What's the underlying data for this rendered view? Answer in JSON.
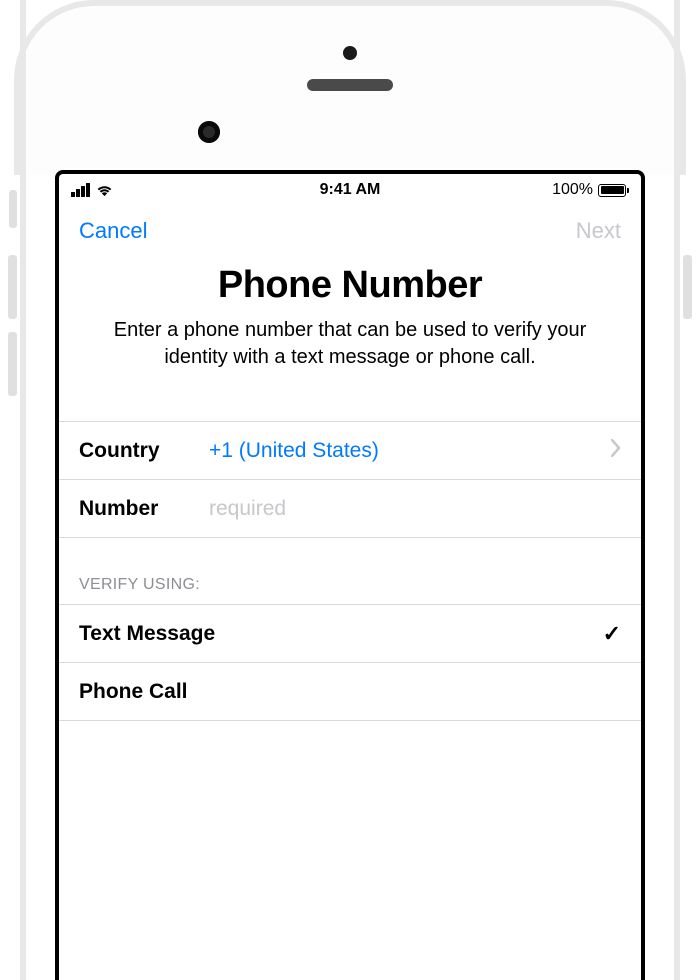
{
  "status_bar": {
    "time": "9:41 AM",
    "battery_pct": "100%"
  },
  "nav": {
    "cancel": "Cancel",
    "next": "Next"
  },
  "header": {
    "title": "Phone Number",
    "subtitle": "Enter a phone number that can be used to verify your identity with a text message or phone call."
  },
  "form": {
    "country_label": "Country",
    "country_value": "+1 (United States)",
    "number_label": "Number",
    "number_placeholder": "required"
  },
  "verify": {
    "section_header": "VERIFY USING:",
    "options": [
      {
        "label": "Text Message",
        "selected": true
      },
      {
        "label": "Phone Call",
        "selected": false
      }
    ]
  }
}
